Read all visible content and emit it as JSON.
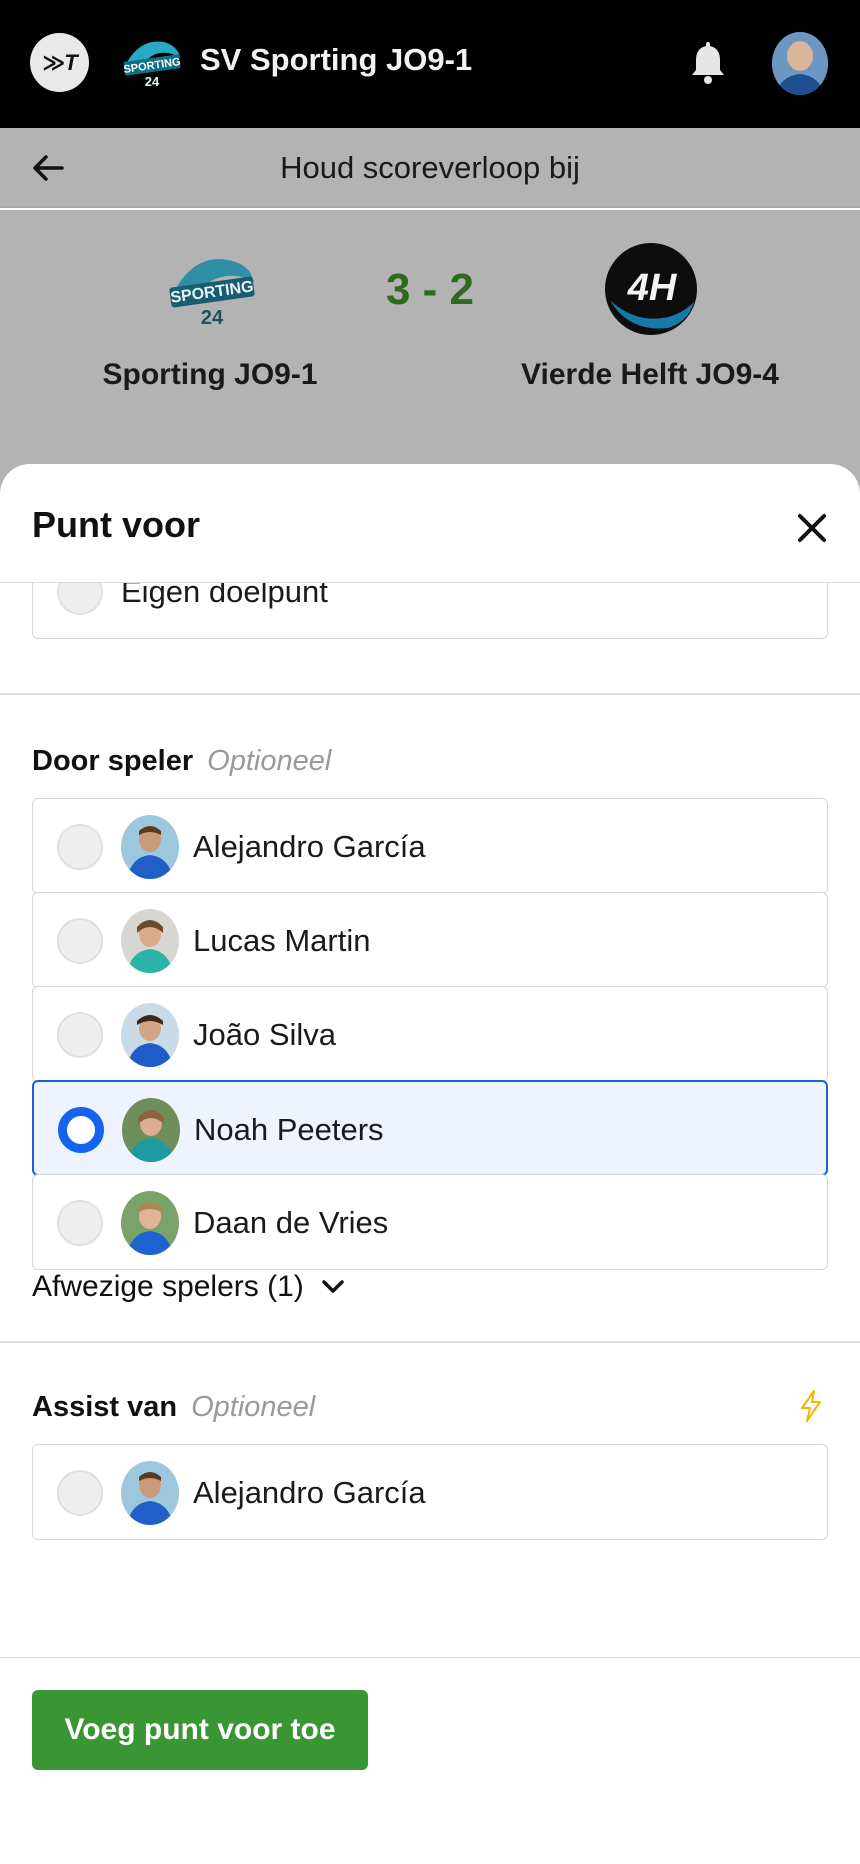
{
  "appbar": {
    "brand_logo_text": "≫T",
    "club_name": "SV Sporting JO9-1",
    "icons": [
      "bell-icon",
      "user-avatar"
    ]
  },
  "page": {
    "title": "Houd scoreverloop bij"
  },
  "match": {
    "home_team": "Sporting JO9-1",
    "away_team": "Vierde Helft JO9-4",
    "score": "3 - 2",
    "away_crest_text": "4H"
  },
  "sheet": {
    "title": "Punt voor",
    "own_goal_label": "Eigen doelpunt",
    "scorer_section": {
      "title": "Door speler",
      "optional": "Optioneel",
      "players": [
        {
          "name": "Alejandro García",
          "selected": false
        },
        {
          "name": "Lucas Martin",
          "selected": false
        },
        {
          "name": "João Silva",
          "selected": false
        },
        {
          "name": "Noah Peeters",
          "selected": true
        },
        {
          "name": "Daan de Vries",
          "selected": false
        }
      ],
      "absent_toggle": "Afwezige spelers (1)"
    },
    "assist_section": {
      "title": "Assist van",
      "optional": "Optioneel",
      "players": [
        {
          "name": "Alejandro García",
          "selected": false
        }
      ]
    },
    "submit_label": "Voeg punt voor toe"
  },
  "colors": {
    "accent_blue": "#1464f0",
    "primary_green": "#3a9634",
    "score_green": "#2e6b1f",
    "bolt_yellow": "#f2b600"
  }
}
